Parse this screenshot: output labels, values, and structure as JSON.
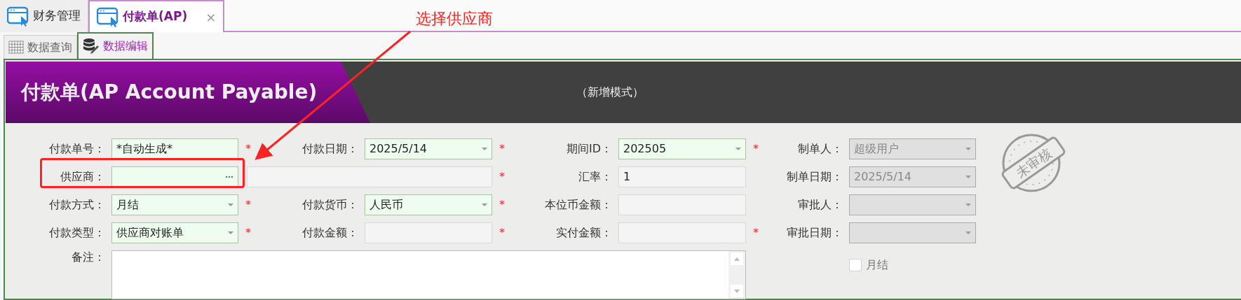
{
  "top_tabs": [
    {
      "label": "财务管理",
      "selected": false
    },
    {
      "label": "付款单(AP)",
      "selected": true,
      "close": "×"
    }
  ],
  "sub_tabs": [
    {
      "label": "数据查询",
      "selected": false,
      "kind": "grid"
    },
    {
      "label": "数据编辑",
      "selected": true,
      "kind": "database"
    }
  ],
  "header": {
    "title": "付款单(AP Account Payable)",
    "mode": "（新增模式）"
  },
  "rows": [
    [
      {
        "label": "付款单号：",
        "value": "*自动生成*",
        "kind": "text",
        "editable": true,
        "disabled": false,
        "required_mark": "*"
      },
      {
        "label": "付款日期：",
        "value": "2025/5/14",
        "kind": "dropdown",
        "editable": true,
        "disabled": false,
        "required_mark": "*"
      },
      {
        "label": "期间ID：",
        "value": "202505",
        "kind": "dropdown",
        "editable": true,
        "disabled": false,
        "required_mark": "*"
      },
      {
        "label": "制单人：",
        "value": "超级用户",
        "kind": "dropdown",
        "editable": false,
        "disabled": true
      }
    ],
    [
      {
        "label": "供应商：",
        "kind": "lookup",
        "editable": true,
        "disabled": false,
        "highlighted": true
      },
      {
        "kind": "wide",
        "editable": false,
        "disabled": false,
        "required_mark": "*"
      },
      {
        "label": "汇率：",
        "value": "1",
        "kind": "text",
        "editable": false,
        "disabled": false
      },
      {
        "label": "制单日期：",
        "value": "2025/5/14",
        "kind": "dropdown",
        "editable": false,
        "disabled": true
      }
    ],
    [
      {
        "label": "付款方式：",
        "value": "月结",
        "kind": "dropdown",
        "editable": true,
        "disabled": false,
        "required_mark": "*"
      },
      {
        "label": "付款货币：",
        "value": "人民币",
        "kind": "dropdown",
        "editable": true,
        "disabled": false,
        "required_mark": "*"
      },
      {
        "label": "本位币金额：",
        "kind": "text",
        "editable": false,
        "disabled": false
      },
      {
        "label": "审批人：",
        "kind": "dropdown",
        "editable": false,
        "disabled": true
      }
    ],
    [
      {
        "label": "付款类型：",
        "value": "供应商对账单",
        "kind": "dropdown",
        "editable": true,
        "disabled": false,
        "required_mark": "*"
      },
      {
        "label": "付款金额：",
        "kind": "text",
        "editable": false,
        "disabled": false,
        "required_mark": "*"
      },
      {
        "label": "实付金额：",
        "kind": "text",
        "editable": false,
        "disabled": false,
        "required_mark": "*"
      },
      {
        "label": "审批日期：",
        "kind": "dropdown",
        "editable": false,
        "disabled": true
      }
    ]
  ],
  "notes": {
    "label": "备注："
  },
  "checkbox": {
    "label": "月结",
    "checked": false,
    "disabled": true
  },
  "stamp": {
    "text": "未审核"
  },
  "annotation": {
    "text": "选择供应商"
  }
}
